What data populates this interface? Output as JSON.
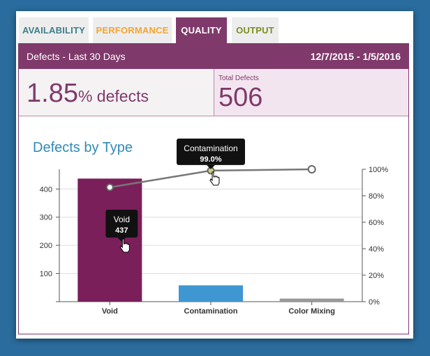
{
  "tabs": [
    {
      "label": "AVAILABILITY"
    },
    {
      "label": "PERFORMANCE"
    },
    {
      "label": "QUALITY"
    },
    {
      "label": "OUTPUT"
    }
  ],
  "active_tab": "QUALITY",
  "header": {
    "title": "Defects - Last 30 Days",
    "date_range": "12/7/2015 - 1/5/2016"
  },
  "kpi": {
    "defect_rate": "1.85",
    "defect_rate_unit": "% defects",
    "total_label": "Total Defects",
    "total_value": "506"
  },
  "colors": {
    "brand": "#7f3a6b",
    "bar_void": "#7a1f5a",
    "bar_contamination": "#3e97d1",
    "line": "#777777"
  },
  "chart_title": "Defects by Type",
  "tooltips": [
    {
      "label": "Contamination",
      "value": "99.0%"
    },
    {
      "label": "Void",
      "value": "437"
    }
  ],
  "chart_data": {
    "type": "bar",
    "title": "Defects by Type",
    "categories": [
      "Void",
      "Contamination",
      "Color Mixing"
    ],
    "series": [
      {
        "type": "bar",
        "values": [
          437,
          58,
          11
        ]
      },
      {
        "type": "line",
        "axis": "right",
        "values": [
          86.4,
          99.0,
          100
        ]
      }
    ],
    "ylim": [
      0,
      470
    ],
    "y_ticks": [
      "100",
      "200",
      "300",
      "400"
    ],
    "y2lim": [
      0,
      100
    ],
    "y2_ticks": [
      "0%",
      "20%",
      "40%",
      "60%",
      "80%",
      "100%"
    ],
    "grid": true
  }
}
